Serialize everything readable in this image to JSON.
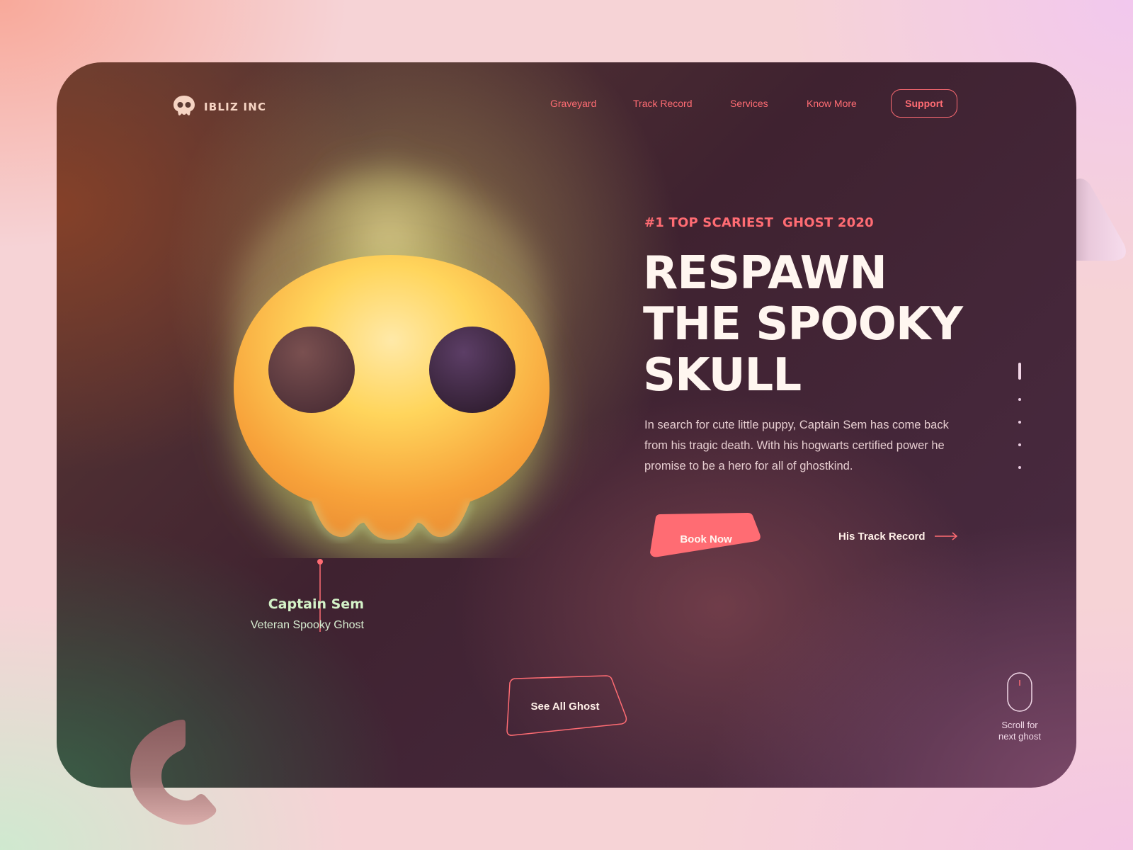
{
  "brand": {
    "name": "IBLIZ INC",
    "logo_icon": "skull-icon"
  },
  "nav": {
    "links": [
      "Graveyard",
      "Track Record",
      "Services",
      "Know More"
    ],
    "support_label": "Support"
  },
  "hero": {
    "tagline": "#1 TOP SCARIEST  GHOST 2020",
    "headline_lines": [
      "RESPAWN",
      "THE SPOOKY",
      "SKULL"
    ],
    "description": "In search for cute little puppy, Captain Sem has come back from his tragic death. With his hogwarts certified power he promise to be a hero for all of ghostkind.",
    "book_label": "Book Now",
    "track_label": "His Track Record",
    "track_icon": "arrow-right-icon"
  },
  "character": {
    "name": "Captain Sem",
    "role": "Veteran Spooky Ghost"
  },
  "slider": {
    "total": 5,
    "active": 1
  },
  "see_all_label": "See All Ghost",
  "scroll_hint": {
    "line1": "Scroll for",
    "line2": "next ghost",
    "icon": "mouse-icon"
  },
  "colors": {
    "accent": "#ff6c73",
    "headline": "#fff6f0",
    "caption": "#d4f2c8"
  }
}
